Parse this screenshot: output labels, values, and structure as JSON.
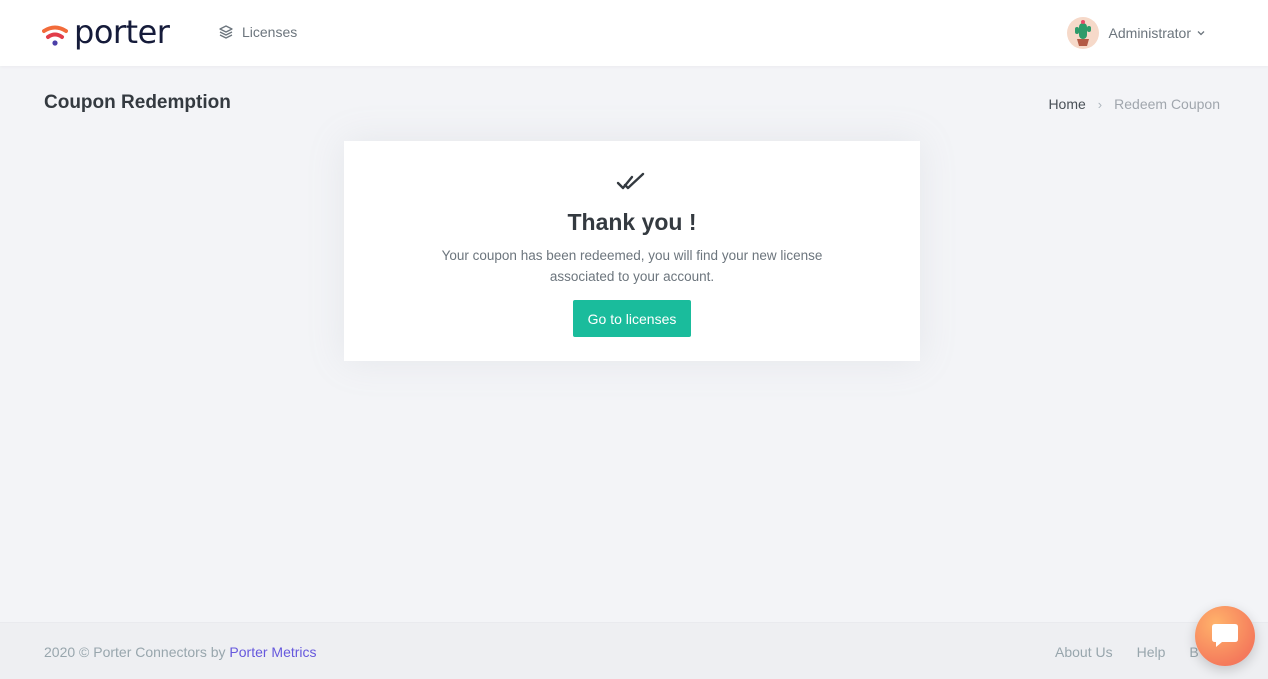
{
  "brand": {
    "name": "porter",
    "colors": {
      "primary": "#1abc9c",
      "link": "#6658dd",
      "logo_text": "#151b3a"
    }
  },
  "topnav": {
    "licenses_label": "Licenses",
    "licenses_icon": "layers-icon",
    "user_name": "Administrator"
  },
  "page": {
    "title": "Coupon Redemption",
    "breadcrumb": {
      "home": "Home",
      "separator": "›",
      "current": "Redeem Coupon"
    }
  },
  "card": {
    "icon": "double-check-icon",
    "title": "Thank you !",
    "message": "Your coupon has been redeemed, you will find your new license associated to your account.",
    "button_label": "Go to licenses"
  },
  "footer": {
    "copyright": "2020 © Porter Connectors by",
    "company_link": "Porter Metrics",
    "links": [
      "About Us",
      "Help",
      "B"
    ]
  },
  "chat": {
    "icon": "chat-bubble-icon"
  }
}
